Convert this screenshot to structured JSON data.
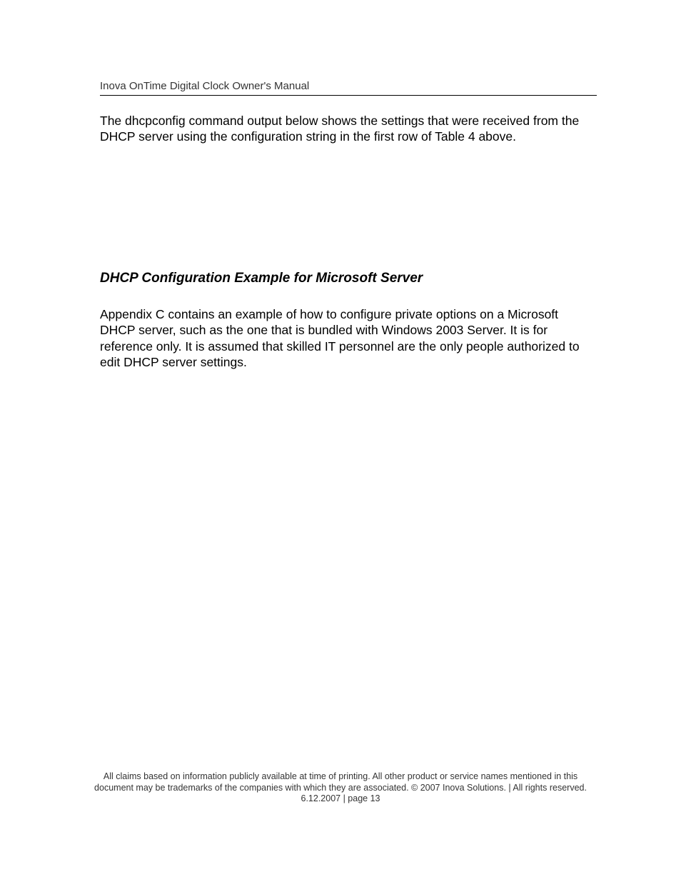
{
  "header": {
    "title": "Inova OnTime Digital Clock Owner's Manual"
  },
  "content": {
    "intro_paragraph": "The dhcpconfig command output below shows the settings that were received from the DHCP server using the configuration string in the first row of Table 4 above.",
    "section_heading": "DHCP Configuration Example for Microsoft Server",
    "section_paragraph": "Appendix C contains an example of how to configure private options on a Microsoft DHCP server, such as the one that is bundled with Windows 2003 Server.  It is for reference only.  It is assumed that skilled IT personnel are the only people authorized to edit DHCP server settings."
  },
  "footer": {
    "text": "All claims based on information publicly available at time of printing. All other product or service names mentioned in this document may be trademarks of the companies with which they are associated. © 2007 Inova Solutions. | All rights reserved. 6.12.2007 | page 13"
  }
}
